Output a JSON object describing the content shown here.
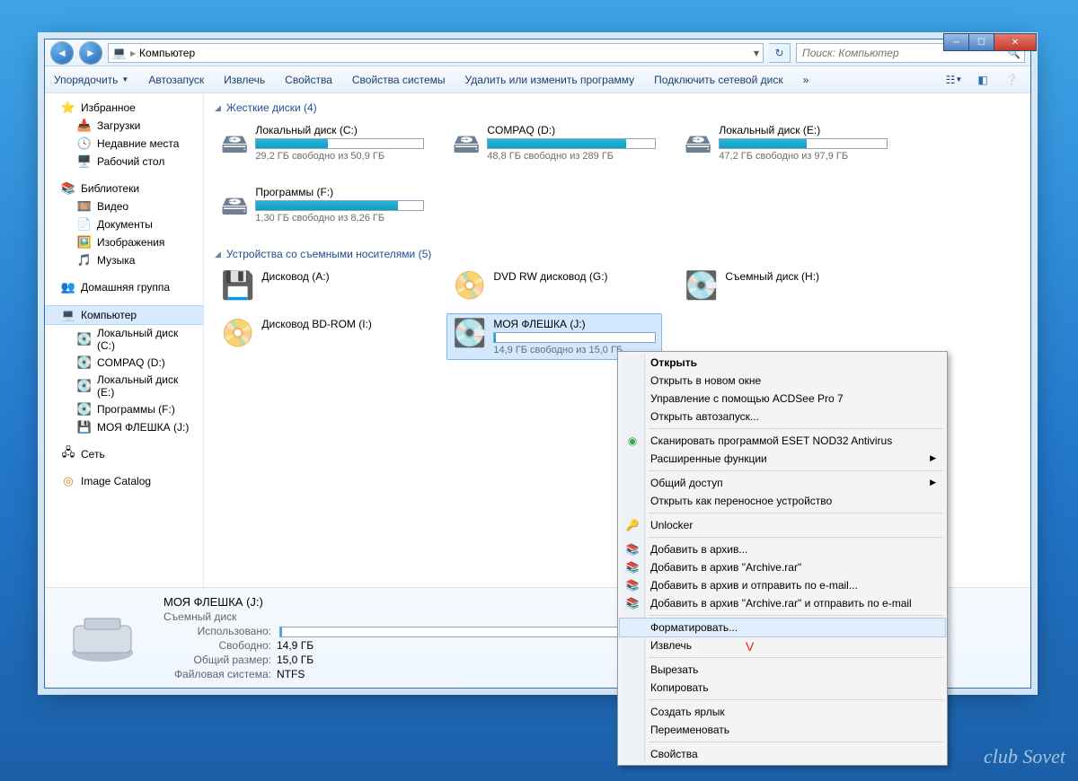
{
  "window": {
    "address_location": "Компьютер",
    "search_placeholder": "Поиск: Компьютер"
  },
  "toolbar": {
    "organize": "Упорядочить",
    "autorun": "Автозапуск",
    "eject": "Извлечь",
    "properties": "Свойства",
    "sysprops": "Свойства системы",
    "uninstall": "Удалить или изменить программу",
    "mapnet": "Подключить сетевой диск",
    "overflow": "»"
  },
  "sidebar": {
    "favorites": "Избранное",
    "fav_items": [
      "Загрузки",
      "Недавние места",
      "Рабочий стол"
    ],
    "libraries": "Библиотеки",
    "lib_items": [
      "Видео",
      "Документы",
      "Изображения",
      "Музыка"
    ],
    "homegroup": "Домашняя группа",
    "computer": "Компьютер",
    "comp_items": [
      "Локальный диск (C:)",
      "COMPAQ (D:)",
      "Локальный диск (E:)",
      "Программы  (F:)",
      "МОЯ ФЛЕШКА (J:)"
    ],
    "network": "Сеть",
    "imgcat": "Image Catalog"
  },
  "sections": {
    "hdd": "Жесткие диски (4)",
    "removable": "Устройства со съемными носителями (5)"
  },
  "drives_hdd": [
    {
      "name": "Локальный диск (C:)",
      "sub": "29,2 ГБ свободно из 50,9 ГБ",
      "pct": 43
    },
    {
      "name": "COMPAQ (D:)",
      "sub": "48,8 ГБ свободно из 289 ГБ",
      "pct": 83
    },
    {
      "name": "Локальный диск (E:)",
      "sub": "47,2 ГБ свободно из 97,9 ГБ",
      "pct": 52
    },
    {
      "name": "Программы  (F:)",
      "sub": "1,30 ГБ свободно из 8,26 ГБ",
      "pct": 85
    }
  ],
  "drives_rem": [
    {
      "name": "Дисковод (A:)"
    },
    {
      "name": "DVD RW дисковод (G:)"
    },
    {
      "name": "Съемный диск (H:)"
    },
    {
      "name": "Дисковод BD-ROM (I:)"
    },
    {
      "name": "МОЯ ФЛЕШКА (J:)",
      "sub": "14,9 ГБ свободно из 15,0 ГБ",
      "pct": 1,
      "selected": true
    }
  ],
  "details": {
    "title": "МОЯ ФЛЕШКА (J:)",
    "type": "Съемный диск",
    "used_label": "Использовано:",
    "free_label": "Свободно:",
    "free_value": "14,9 ГБ",
    "total_label": "Общий размер:",
    "total_value": "15,0 ГБ",
    "fs_label": "Файловая система:",
    "fs_value": "NTFS"
  },
  "context_menu": [
    {
      "label": "Открыть",
      "bold": true
    },
    {
      "label": "Открыть в новом окне"
    },
    {
      "label": "Управление с помощью ACDSee Pro 7"
    },
    {
      "label": "Открыть автозапуск..."
    },
    {
      "sep": true
    },
    {
      "label": "Сканировать программой ESET NOD32 Antivirus",
      "icon": "◉",
      "iconColor": "#2fa84f"
    },
    {
      "label": "Расширенные функции",
      "submenu": true
    },
    {
      "sep": true
    },
    {
      "label": "Общий доступ",
      "submenu": true
    },
    {
      "label": "Открыть как переносное устройство"
    },
    {
      "sep": true
    },
    {
      "label": "Unlocker",
      "icon": "🔑"
    },
    {
      "sep": true
    },
    {
      "label": "Добавить в архив...",
      "icon": "📚"
    },
    {
      "label": "Добавить в архив \"Archive.rar\"",
      "icon": "📚"
    },
    {
      "label": "Добавить в архив и отправить по e-mail...",
      "icon": "📚"
    },
    {
      "label": "Добавить в архив \"Archive.rar\" и отправить по e-mail",
      "icon": "📚"
    },
    {
      "sep": true
    },
    {
      "label": "Форматировать...",
      "hover": true
    },
    {
      "label": "Извлечь"
    },
    {
      "sep": true
    },
    {
      "label": "Вырезать"
    },
    {
      "label": "Копировать"
    },
    {
      "sep": true
    },
    {
      "label": "Создать ярлык"
    },
    {
      "label": "Переименовать"
    },
    {
      "sep": true
    },
    {
      "label": "Свойства"
    }
  ],
  "watermark": "club Sovet"
}
